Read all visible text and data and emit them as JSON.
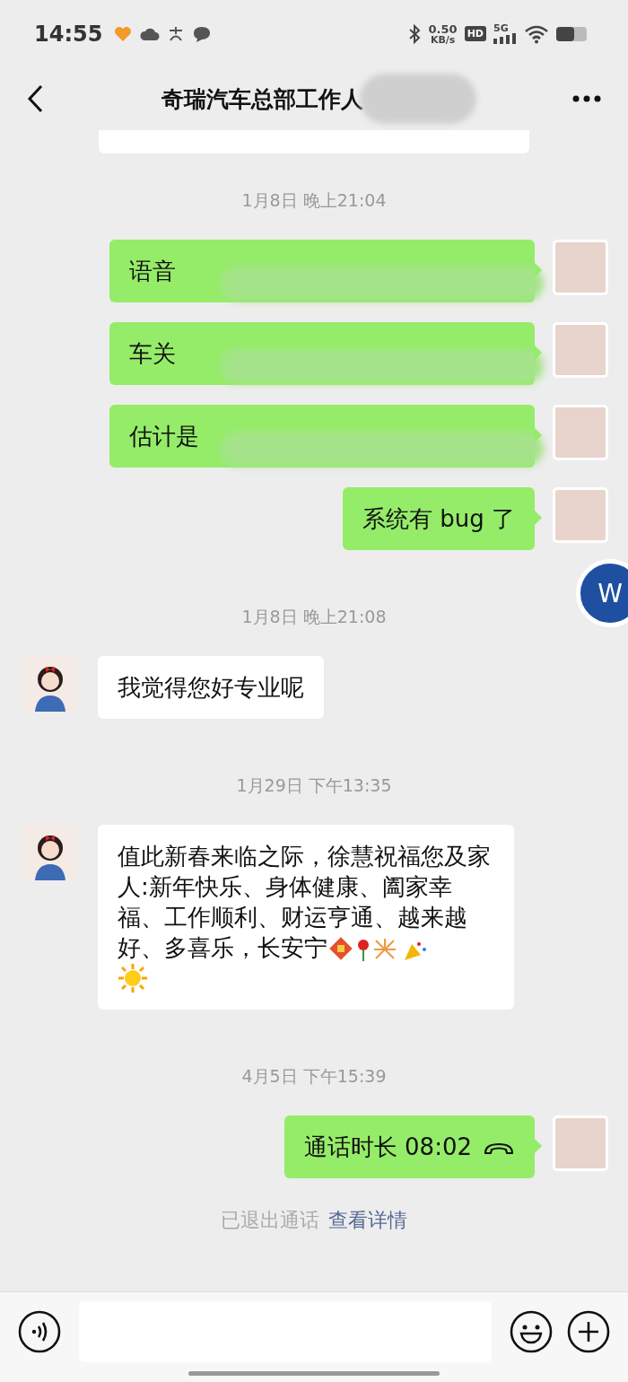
{
  "status_bar": {
    "time": "14:55",
    "network_speed": "0.50",
    "network_speed_unit": "KB/s",
    "hd": "HD",
    "signal": "5G"
  },
  "header": {
    "title": "奇瑞汽车总部工作人"
  },
  "messages": [
    {
      "kind": "fragment"
    },
    {
      "kind": "time",
      "text": "1月8日 晚上21:04"
    },
    {
      "kind": "sent",
      "text": "语音",
      "redacted": true
    },
    {
      "kind": "sent",
      "text": "车关",
      "redacted": true
    },
    {
      "kind": "sent",
      "text": "估计是",
      "redacted": true
    },
    {
      "kind": "sent",
      "text": "系统有 bug 了",
      "redacted": false
    },
    {
      "kind": "time",
      "text": "1月8日 晚上21:08"
    },
    {
      "kind": "received",
      "text": "我觉得您好专业呢"
    },
    {
      "kind": "time",
      "text": "1月29日 下午13:35"
    },
    {
      "kind": "received",
      "text": "值此新春来临之际，徐慧祝福您及家人:新年快乐、身体健康、阖家幸福、工作顺利、财运亨通、越来越好、多喜乐，长安宁",
      "emoji": true
    },
    {
      "kind": "time",
      "text": "4月5日 下午15:39"
    },
    {
      "kind": "call",
      "text": "通话时长 08:02"
    },
    {
      "kind": "system",
      "text": "已退出通话",
      "link": "查看详情"
    }
  ],
  "floating_badge": {
    "letter": "W"
  }
}
